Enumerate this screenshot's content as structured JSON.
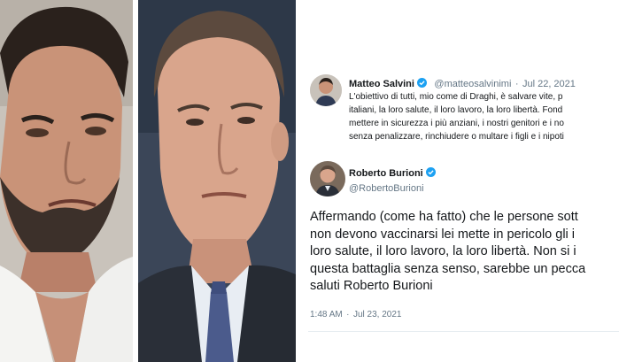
{
  "tweet1": {
    "author_name": "Matteo Salvini",
    "author_handle": "@matteosalvinimi",
    "separator": "·",
    "date": "Jul 22, 2021",
    "lines": [
      "L'obiettivo di tutti, mio come di Draghi, è salvare vite, p",
      "italiani, la loro salute, il loro lavoro, la loro libertà. Fond",
      "mettere in sicurezza i più anziani, i nostri genitori e i no",
      "senza penalizzare, rinchiudere o multare i figli e i nipoti"
    ]
  },
  "tweet2": {
    "author_name": "Roberto Burioni",
    "author_handle": "@RobertoBurioni",
    "lines": [
      "Affermando (come ha fatto) che le persone sott",
      "non devono vaccinarsi lei mette in pericolo gli i",
      "loro salute, il loro lavoro, la loro libertà. Non si i",
      "questa battaglia senza senso, sarebbe un pecca",
      "saluti Roberto Burioni"
    ],
    "time": "1:48 AM",
    "separator": "·",
    "date": "Jul 23, 2021"
  },
  "colors": {
    "verified_blue": "#1da1f2",
    "text_primary": "#14171a",
    "text_secondary": "#657786"
  },
  "icons": {
    "verified": "verified-badge-icon"
  }
}
